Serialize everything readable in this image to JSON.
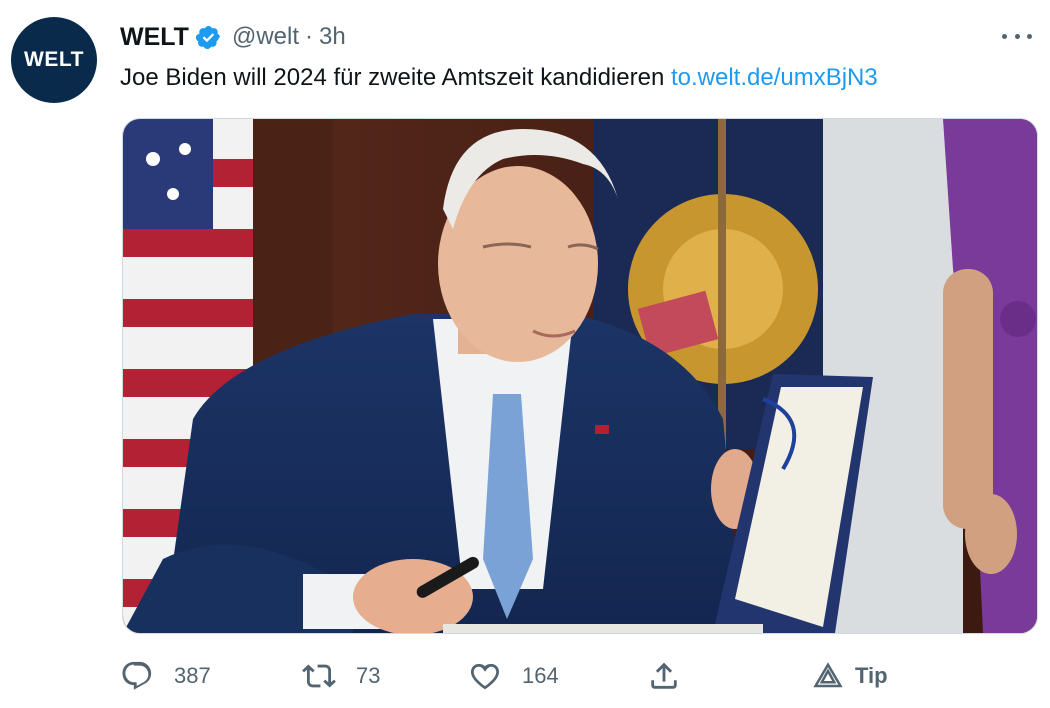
{
  "tweet": {
    "avatar_text": "WELT",
    "author_name": "WELT",
    "handle": "@welt",
    "separator": "·",
    "time": "3h",
    "text": "Joe Biden will 2024 für zweite Amtszeit kandidieren",
    "link": "to.welt.de/umxBjN3"
  },
  "actions": {
    "reply_count": "387",
    "retweet_count": "73",
    "like_count": "164",
    "tip_label": "Tip"
  },
  "icons": {
    "verified": "verified-badge-icon",
    "more": "more-dots-icon",
    "reply": "reply-icon",
    "retweet": "retweet-icon",
    "like": "heart-icon",
    "share": "share-icon",
    "tip": "tip-icon"
  },
  "colors": {
    "brand_avatar": "#0a2a4c",
    "link": "#1d9bf0",
    "verified": "#1d9bf0",
    "muted": "#536471"
  }
}
